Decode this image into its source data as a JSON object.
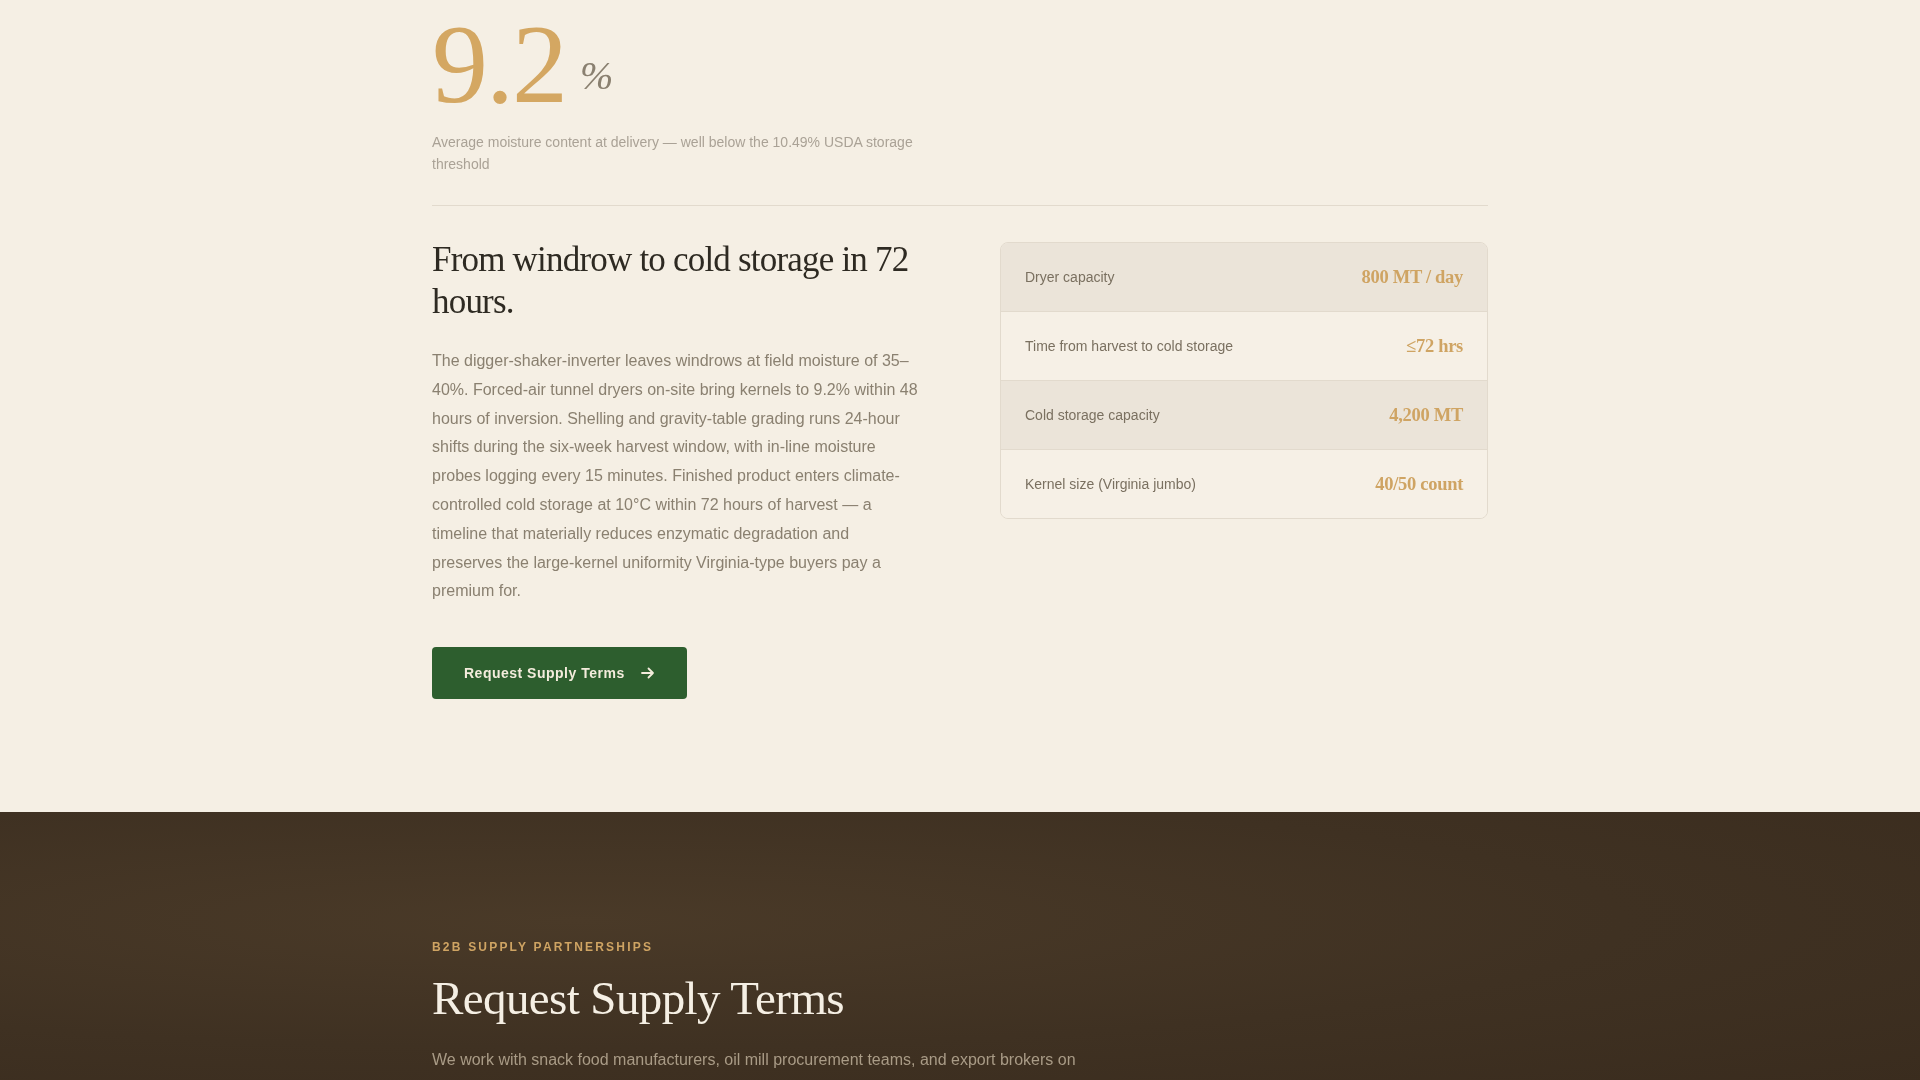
{
  "moisture_stat": {
    "value": "9.2",
    "unit": "%",
    "caption": "Average moisture content at delivery — well below the 10.49% USDA storage threshold"
  },
  "process": {
    "heading": "From windrow to cold storage in 72 hours.",
    "body": "The digger-shaker-inverter leaves windrows at field moisture of 35–40%. Forced-air tunnel dryers on-site bring kernels to 9.2% within 48 hours of inversion. Shelling and gravity-table grading runs 24-hour shifts during the six-week harvest window, with in-line moisture probes logging every 15 minutes. Finished product enters climate-controlled cold storage at 10°C within 72 hours of harvest — a timeline that materially reduces enzymatic degradation and preserves the large-kernel uniformity Virginia-type buyers pay a premium for.",
    "button": {
      "label": "Request Supply Terms"
    }
  },
  "specs": [
    {
      "label": "Dryer capacity",
      "value": "800 MT / day"
    },
    {
      "label": "Time from harvest to cold storage",
      "value": "≤72 hrs"
    },
    {
      "label": "Cold storage capacity",
      "value": "4,200 MT"
    },
    {
      "label": "Kernel size (Virginia jumbo)",
      "value": "40/50 count"
    }
  ],
  "supply_section": {
    "eyebrow": "B2B SUPPLY PARTNERSHIPS",
    "heading": "Request Supply Terms",
    "intro": "We work with snack food manufacturers, oil mill procurement teams, and export brokers on"
  }
}
